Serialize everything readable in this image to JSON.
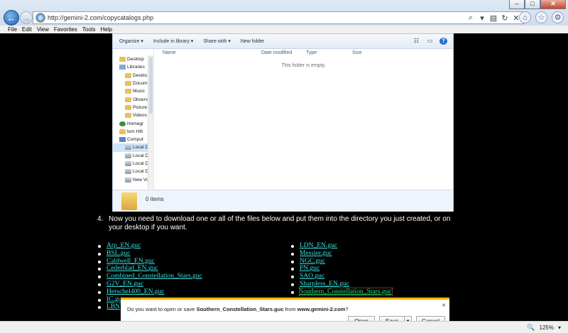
{
  "browser": {
    "url": "http://gemini-2.com/copycatalogs.php",
    "window_buttons": [
      "–",
      "□",
      "✕"
    ]
  },
  "menubar": [
    "File",
    "Edit",
    "View",
    "Favorites",
    "Tools",
    "Help"
  ],
  "explorer": {
    "toolbar": [
      "Organize ▾",
      "Include in library ▾",
      "Share with ▾",
      "New folder"
    ],
    "nav_items": [
      {
        "label": "Desktop",
        "icon": "folder",
        "indent": 0
      },
      {
        "label": "Libraries",
        "icon": "lib",
        "indent": 0
      },
      {
        "label": "Deskto",
        "icon": "folder",
        "indent": 1
      },
      {
        "label": "Docum",
        "icon": "folder",
        "indent": 1
      },
      {
        "label": "Music",
        "icon": "folder",
        "indent": 1
      },
      {
        "label": "Observ",
        "icon": "folder",
        "indent": 1
      },
      {
        "label": "Picture",
        "icon": "folder",
        "indent": 1
      },
      {
        "label": "Videos",
        "icon": "folder",
        "indent": 1
      },
      {
        "label": "Homegr",
        "icon": "group",
        "indent": 0
      },
      {
        "label": "tom Hilt",
        "icon": "folder",
        "indent": 0
      },
      {
        "label": "Comput",
        "icon": "comp",
        "indent": 0
      },
      {
        "label": "Local D",
        "icon": "drive",
        "indent": 1,
        "selected": true
      },
      {
        "label": "Local D",
        "icon": "drive",
        "indent": 1
      },
      {
        "label": "Local D",
        "icon": "drive",
        "indent": 1
      },
      {
        "label": "Local D",
        "icon": "drive",
        "indent": 1
      },
      {
        "label": "New Vo",
        "icon": "drive",
        "indent": 1
      }
    ],
    "columns": {
      "name": "Name",
      "date": "Date modified",
      "type": "Type",
      "size": "Size"
    },
    "empty_message": "This folder is empty.",
    "item_count": "0 items"
  },
  "step": {
    "number": "4.",
    "text": "Now you need to download one or all of the files below and put them into the directory you just created, or on your desktop if you want."
  },
  "files_left": [
    "Arp_EN.guc",
    "BSL.guc",
    "Caldwell_EN.guc",
    "Cederblad_EN.guc",
    "Combined_Constellation_Stars.guc",
    "G2V_EN.guc",
    "Herschel400_EN.guc",
    "IC.gu",
    "LBN"
  ],
  "files_right": [
    "LDN_EN.guc",
    "Messier.guc",
    "NGC.guc",
    "PN.guc",
    "SAO.guc",
    "Sharpless_EN.guc",
    "Southern_Constellation_Stars.guc"
  ],
  "download": {
    "prefix": "Do you want to open or save ",
    "filename": "Southern_Constellation_Stars.guc",
    "middle": " from ",
    "site": "www.gemini-2.com",
    "suffix": "?",
    "open": "Open",
    "save": "Save",
    "cancel": "Cancel",
    "close": "×"
  },
  "zoom": "125%",
  "colors": {
    "link": "#3ee0e0",
    "visited_link": "#32e07c",
    "accent": "#f4b400"
  }
}
